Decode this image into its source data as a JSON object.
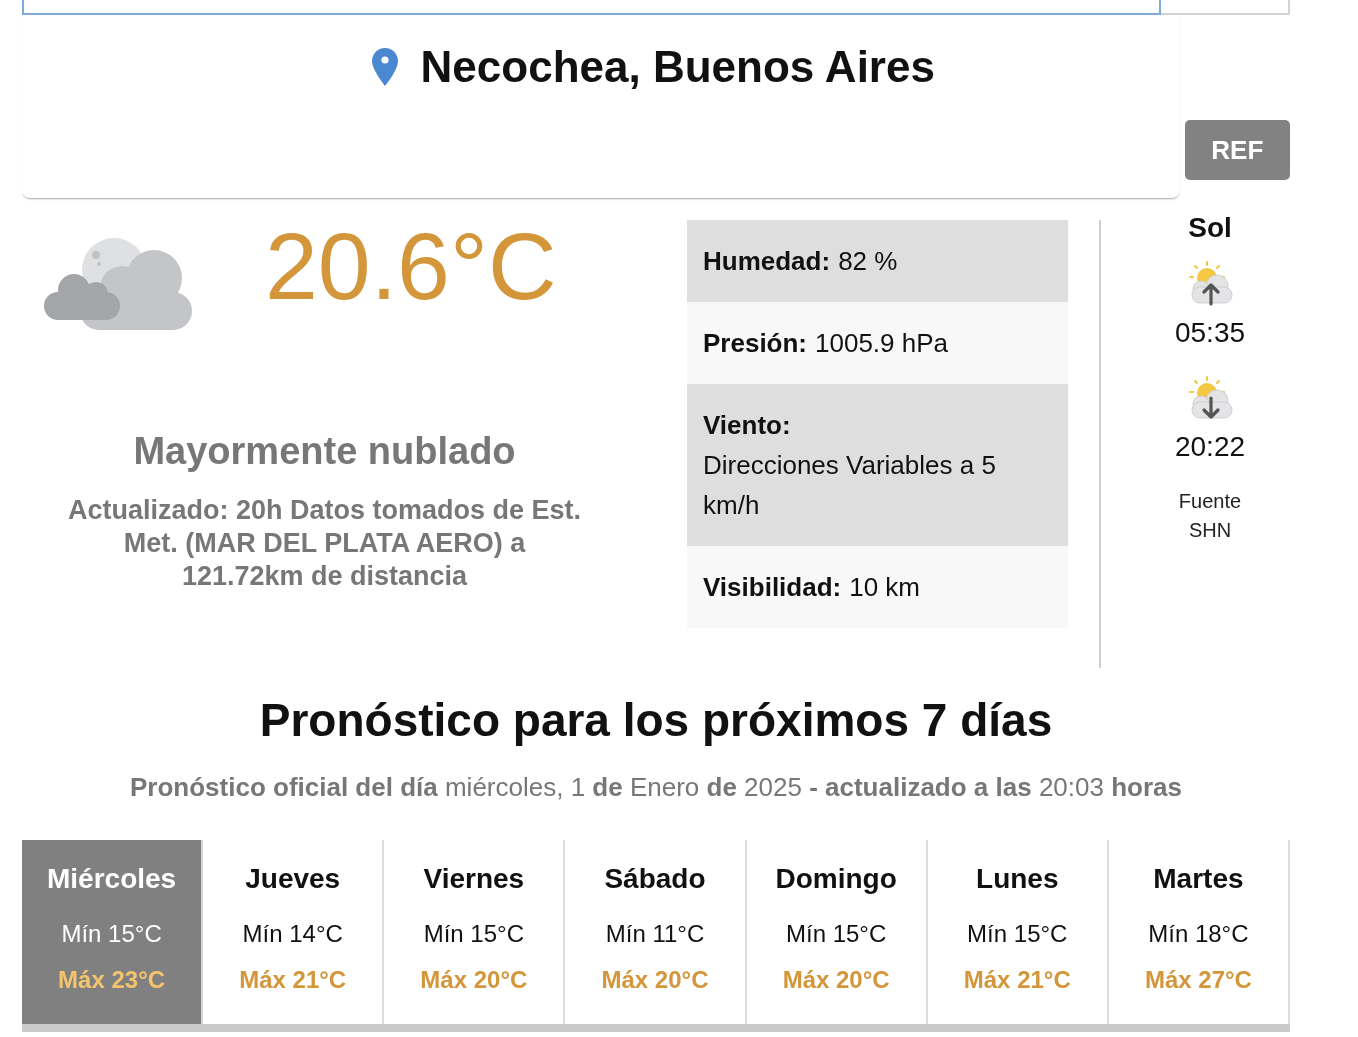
{
  "location": {
    "title": "Necochea, Buenos Aires"
  },
  "ref_button": {
    "label": "REF"
  },
  "current": {
    "temperature": "20.6°C",
    "condition": "Mayormente nublado",
    "updated": "Actualizado: 20h Datos tomados de Est. Met. (MAR DEL PLATA AERO) a 121.72km de distancia"
  },
  "details": [
    {
      "kind": "inline",
      "label": "Humedad:",
      "value": "82 %"
    },
    {
      "kind": "inline",
      "label": "Presión:",
      "value": "1005.9 hPa"
    },
    {
      "kind": "stacked",
      "label": "Viento:",
      "value": "Direcciones Variables a 5 km/h"
    },
    {
      "kind": "inline",
      "label": "Visibilidad:",
      "value": "10 km"
    }
  ],
  "sun": {
    "title": "Sol",
    "events": [
      {
        "kind": "sunrise",
        "time": "05:35"
      },
      {
        "kind": "sunset",
        "time": "20:22"
      }
    ],
    "source": "Fuente SHN"
  },
  "forecast": {
    "title": "Pronóstico para los próximos 7 días",
    "subtitle": "**Pronóstico oficial del día** miércoles, 1 **de** Enero **de** 2025 **- actualizado a las** 20:03 **horas**",
    "days": [
      {
        "name": "Miércoles",
        "min": "Mín 15°C",
        "max": "Máx 23°C",
        "selected": true
      },
      {
        "name": "Jueves",
        "min": "Mín 14°C",
        "max": "Máx 21°C",
        "selected": false
      },
      {
        "name": "Viernes",
        "min": "Mín 15°C",
        "max": "Máx 20°C",
        "selected": false
      },
      {
        "name": "Sábado",
        "min": "Mín 11°C",
        "max": "Máx 20°C",
        "selected": false
      },
      {
        "name": "Domingo",
        "min": "Mín 15°C",
        "max": "Máx 20°C",
        "selected": false
      },
      {
        "name": "Lunes",
        "min": "Mín 15°C",
        "max": "Máx 21°C",
        "selected": false
      },
      {
        "name": "Martes",
        "min": "Mín 18°C",
        "max": "Máx 27°C",
        "selected": false
      }
    ]
  }
}
